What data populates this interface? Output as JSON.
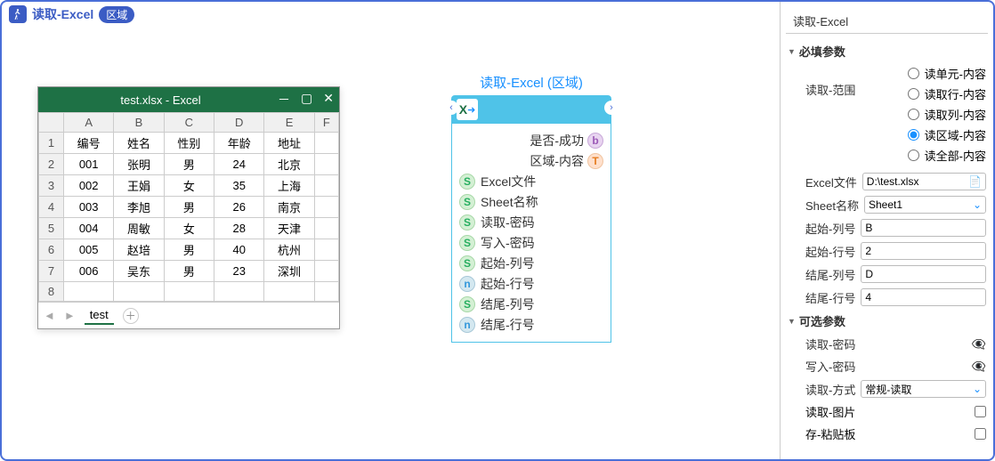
{
  "header": {
    "title": "读取-Excel",
    "badge": "区域"
  },
  "excel_mock": {
    "file_title": "test.xlsx  -  Excel",
    "columns": [
      "A",
      "B",
      "C",
      "D",
      "E",
      "F"
    ],
    "rows": [
      [
        "编号",
        "姓名",
        "性别",
        "年龄",
        "地址"
      ],
      [
        "001",
        "张明",
        "男",
        "24",
        "北京"
      ],
      [
        "002",
        "王娟",
        "女",
        "35",
        "上海"
      ],
      [
        "003",
        "李旭",
        "男",
        "26",
        "南京"
      ],
      [
        "004",
        "周敏",
        "女",
        "28",
        "天津"
      ],
      [
        "005",
        "赵培",
        "男",
        "40",
        "杭州"
      ],
      [
        "006",
        "吴东",
        "男",
        "23",
        "深圳"
      ]
    ],
    "sheet_tab": "test"
  },
  "node": {
    "title": "读取-Excel (区域)",
    "outputs": [
      "是否-成功",
      "区域-内容"
    ],
    "inputs": [
      {
        "type": "s",
        "label": "Excel文件"
      },
      {
        "type": "s",
        "label": "Sheet名称"
      },
      {
        "type": "s",
        "label": "读取-密码"
      },
      {
        "type": "s",
        "label": "写入-密码"
      },
      {
        "type": "s",
        "label": "起始-列号"
      },
      {
        "type": "n",
        "label": "起始-行号"
      },
      {
        "type": "s",
        "label": "结尾-列号"
      },
      {
        "type": "n",
        "label": "结尾-行号"
      }
    ]
  },
  "sidebar": {
    "panel_tab": "读取-Excel",
    "section_required": "必填参数",
    "section_optional": "可选参数",
    "range_label": "读取-范围",
    "range_options": [
      "读单元-内容",
      "读取行-内容",
      "读取列-内容",
      "读区域-内容",
      "读全部-内容"
    ],
    "range_selected": 3,
    "fields": {
      "excel_file": {
        "label": "Excel文件",
        "value": "D:\\test.xlsx"
      },
      "sheet_name": {
        "label": "Sheet名称",
        "value": "Sheet1"
      },
      "start_col": {
        "label": "起始-列号",
        "value": "B"
      },
      "start_row": {
        "label": "起始-行号",
        "value": "2"
      },
      "end_col": {
        "label": "结尾-列号",
        "value": "D"
      },
      "end_row": {
        "label": "结尾-行号",
        "value": "4"
      },
      "read_pwd": {
        "label": "读取-密码",
        "value": ""
      },
      "write_pwd": {
        "label": "写入-密码",
        "value": ""
      },
      "read_mode": {
        "label": "读取-方式",
        "value": "常规-读取"
      },
      "read_image": {
        "label": "读取-图片"
      },
      "clipboard": {
        "label": "存-粘贴板"
      }
    }
  }
}
